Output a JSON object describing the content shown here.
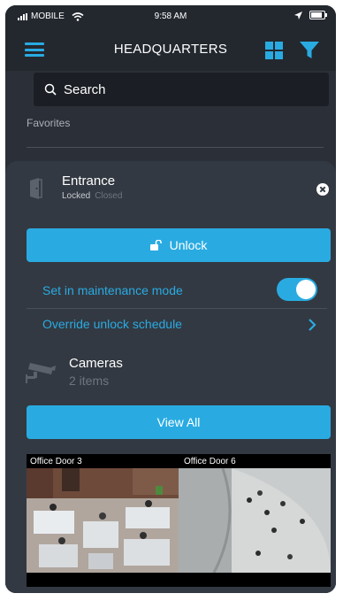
{
  "status_bar": {
    "carrier": "MOBILE",
    "time": "9:58 AM",
    "battery_level": 0.85
  },
  "header": {
    "title": "HEADQUARTERS",
    "icons": [
      "menu-icon",
      "grid-view-icon",
      "filter-icon"
    ]
  },
  "search": {
    "placeholder": "Search",
    "value": ""
  },
  "favorites": {
    "label": "Favorites"
  },
  "door": {
    "name": "Entrance",
    "lock_state": "Locked",
    "door_state": "Closed",
    "unlock_label": "Unlock",
    "maintenance_label": "Set in maintenance mode",
    "maintenance_enabled": true,
    "override_label": "Override unlock schedule"
  },
  "cameras": {
    "title": "Cameras",
    "count_text": "2 items",
    "view_all_label": "View All",
    "feeds": [
      {
        "label": "Office Door 3"
      },
      {
        "label": "Office Door 6"
      }
    ]
  },
  "colors": {
    "accent": "#29abe2",
    "background": "#2b3038",
    "card": "#333942",
    "header": "#23282f",
    "muted_text": "#6f757e"
  }
}
